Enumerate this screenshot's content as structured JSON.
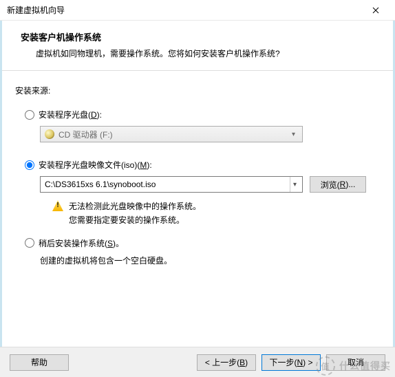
{
  "window": {
    "title": "新建虚拟机向导"
  },
  "header": {
    "title": "安装客户机操作系统",
    "subtitle": "虚拟机如同物理机，需要操作系统。您将如何安装客户机操作系统?"
  },
  "source": {
    "label": "安装来源:",
    "disc": {
      "label_prefix": "安装程序光盘(",
      "label_mnemonic": "D",
      "label_suffix": "):",
      "combo_value": "CD 驱动器 (F:)"
    },
    "iso": {
      "label_prefix": "安装程序光盘映像文件(iso)(",
      "label_mnemonic": "M",
      "label_suffix": "):",
      "path": "C:\\DS3615xs 6.1\\synoboot.iso",
      "browse_prefix": "浏览(",
      "browse_mnemonic": "R",
      "browse_suffix": ")...",
      "warning_line1": "无法检测此光盘映像中的操作系统。",
      "warning_line2": "您需要指定要安装的操作系统。"
    },
    "later": {
      "label_prefix": "稍后安装操作系统(",
      "label_mnemonic": "S",
      "label_suffix": ")。",
      "description": "创建的虚拟机将包含一个空白硬盘。"
    }
  },
  "footer": {
    "help": "帮助",
    "back_prefix": "< 上一步(",
    "back_mnemonic": "B",
    "back_suffix": ")",
    "next_prefix": "下一步(",
    "next_mnemonic": "N",
    "next_suffix": ") >",
    "cancel": "取消"
  },
  "watermark": {
    "badge": "值",
    "text": "什么值得买"
  }
}
